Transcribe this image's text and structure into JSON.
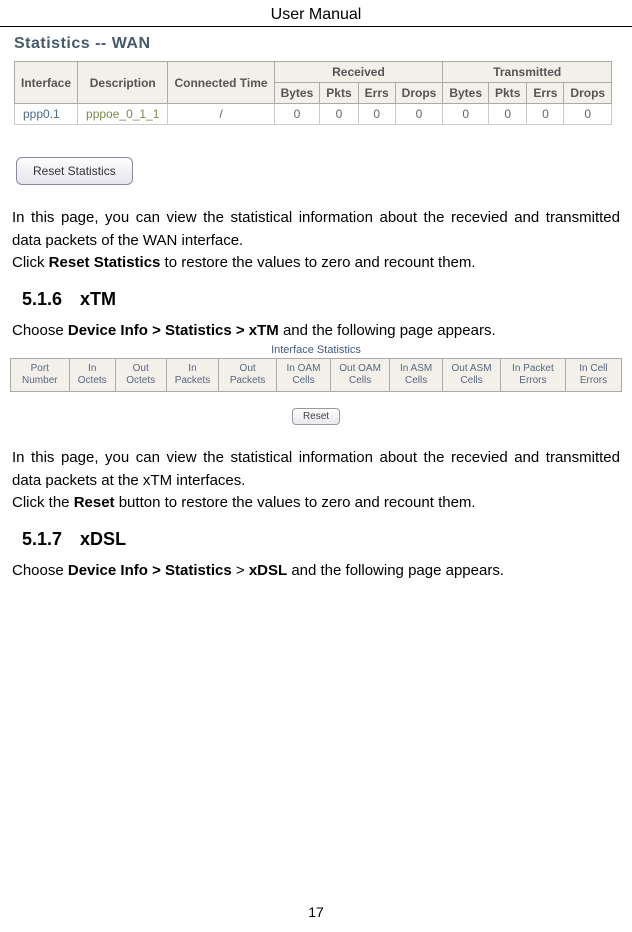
{
  "header": {
    "title": "User Manual"
  },
  "wan": {
    "panel_title": "Statistics -- WAN",
    "headers": {
      "interface": "Interface",
      "description": "Description",
      "connected_time": "Connected Time",
      "received": "Received",
      "transmitted": "Transmitted",
      "sub": [
        "Bytes",
        "Pkts",
        "Errs",
        "Drops",
        "Bytes",
        "Pkts",
        "Errs",
        "Drops"
      ]
    },
    "row": {
      "interface": "ppp0.1",
      "description": "pppoe_0_1_1",
      "connected_time": "/",
      "cells": [
        "0",
        "0",
        "0",
        "0",
        "0",
        "0",
        "0",
        "0"
      ]
    },
    "reset_label": "Reset Statistics"
  },
  "text": {
    "p1a": "In this page, you can view the statistical information about the recevied and transmitted data packets of the WAN interface.",
    "p1b_pre": "Click ",
    "p1b_bold": "Reset Statistics",
    "p1b_post": " to restore the values to zero and recount them.",
    "s516_num": "5.1.6",
    "s516_title": "xTM",
    "p2_pre": "Choose ",
    "p2_bold": "Device Info > Statistics > xTM",
    "p2_post": " and the following page appears.",
    "xtm_caption": "Interface Statistics",
    "p3a": "In this page, you can view the statistical information about the recevied and transmitted data packets at the xTM interfaces.",
    "p3b_pre": "Click the ",
    "p3b_bold": "Reset",
    "p3b_post": " button to restore the values to zero and recount them.",
    "s517_num": "5.1.7",
    "s517_title": "xDSL",
    "p4_pre": "Choose ",
    "p4_bold1": "Device Info > Statistics",
    "p4_mid": " > ",
    "p4_bold2": "xDSL",
    "p4_post": " and the following page appears."
  },
  "xtm": {
    "headers": [
      "Port\nNumber",
      "In\nOctets",
      "Out\nOctets",
      "In\nPackets",
      "Out\nPackets",
      "In OAM\nCells",
      "Out OAM\nCells",
      "In ASM\nCells",
      "Out ASM\nCells",
      "In Packet\nErrors",
      "In Cell\nErrors"
    ],
    "reset_label": "Reset"
  },
  "page_number": "17"
}
